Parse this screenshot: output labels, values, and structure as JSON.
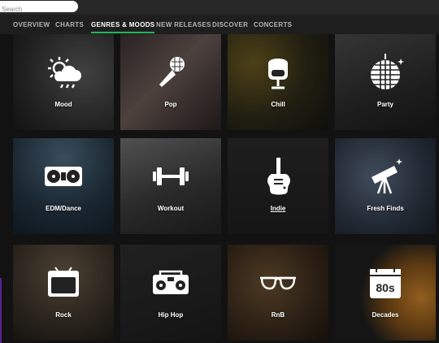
{
  "search": {
    "placeholder": "Search"
  },
  "tabs": [
    {
      "label": "OVERVIEW"
    },
    {
      "label": "CHARTS"
    },
    {
      "label": "GENRES & MOODS"
    },
    {
      "label": "NEW RELEASES"
    },
    {
      "label": "DISCOVER"
    },
    {
      "label": "CONCERTS"
    }
  ],
  "active_tab": "GENRES & MOODS",
  "colors": {
    "accent": "#1db954",
    "background": "#121212",
    "tab_bar": "#1e1e1e"
  },
  "tiles": [
    {
      "label": "Mood",
      "icon": "weather-icon"
    },
    {
      "label": "Pop",
      "icon": "microphone-icon"
    },
    {
      "label": "Chill",
      "icon": "egg-chair-icon"
    },
    {
      "label": "Party",
      "icon": "disco-ball-icon"
    },
    {
      "label": "EDM/Dance",
      "icon": "turntables-icon"
    },
    {
      "label": "Workout",
      "icon": "dumbbell-icon"
    },
    {
      "label": "Indie",
      "icon": "electric-guitar-icon"
    },
    {
      "label": "Fresh Finds",
      "icon": "telescope-icon"
    },
    {
      "label": "Rock",
      "icon": "amplifier-icon"
    },
    {
      "label": "Hip Hop",
      "icon": "boombox-icon"
    },
    {
      "label": "RnB",
      "icon": "sunglasses-icon"
    },
    {
      "label": "Decades",
      "icon": "calendar-80s-icon"
    }
  ],
  "decades_badge": "80s"
}
